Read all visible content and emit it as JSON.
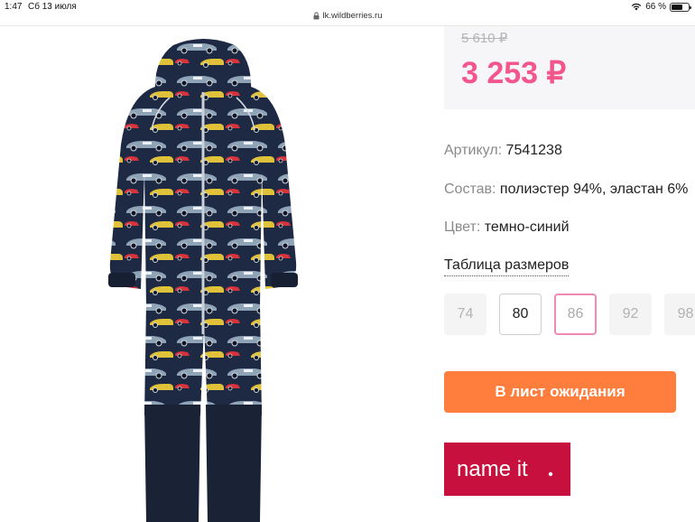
{
  "status": {
    "time": "1:47",
    "date": "Сб 13 июля",
    "battery": "66 %",
    "battery_level": 0.66
  },
  "browser": {
    "url": "lk.wildberries.ru"
  },
  "product": {
    "image_alt": "Комбинезон",
    "old_price": "5 610 ₽",
    "price": "3 253 ₽",
    "article_label": "Артикул:",
    "article_value": "7541238",
    "composition_label": "Состав:",
    "composition_value": "полиэстер 94%, эластан 6%",
    "color_label": "Цвет:",
    "color_value": "темно-синий",
    "size_table_label": "Таблица размеров",
    "sizes": [
      {
        "label": "74",
        "state": "unavailable"
      },
      {
        "label": "80",
        "state": "available"
      },
      {
        "label": "86",
        "state": "selected"
      },
      {
        "label": "92",
        "state": "unavailable"
      },
      {
        "label": "98",
        "state": "unavailable"
      }
    ],
    "wait_button_label": "В лист ожидания",
    "brand_name": "name it."
  },
  "colors": {
    "price_pink": "#f2568a",
    "button_orange": "#ff7e3e",
    "brand_red": "#c8103e",
    "suit_navy": "#1e2a44"
  }
}
